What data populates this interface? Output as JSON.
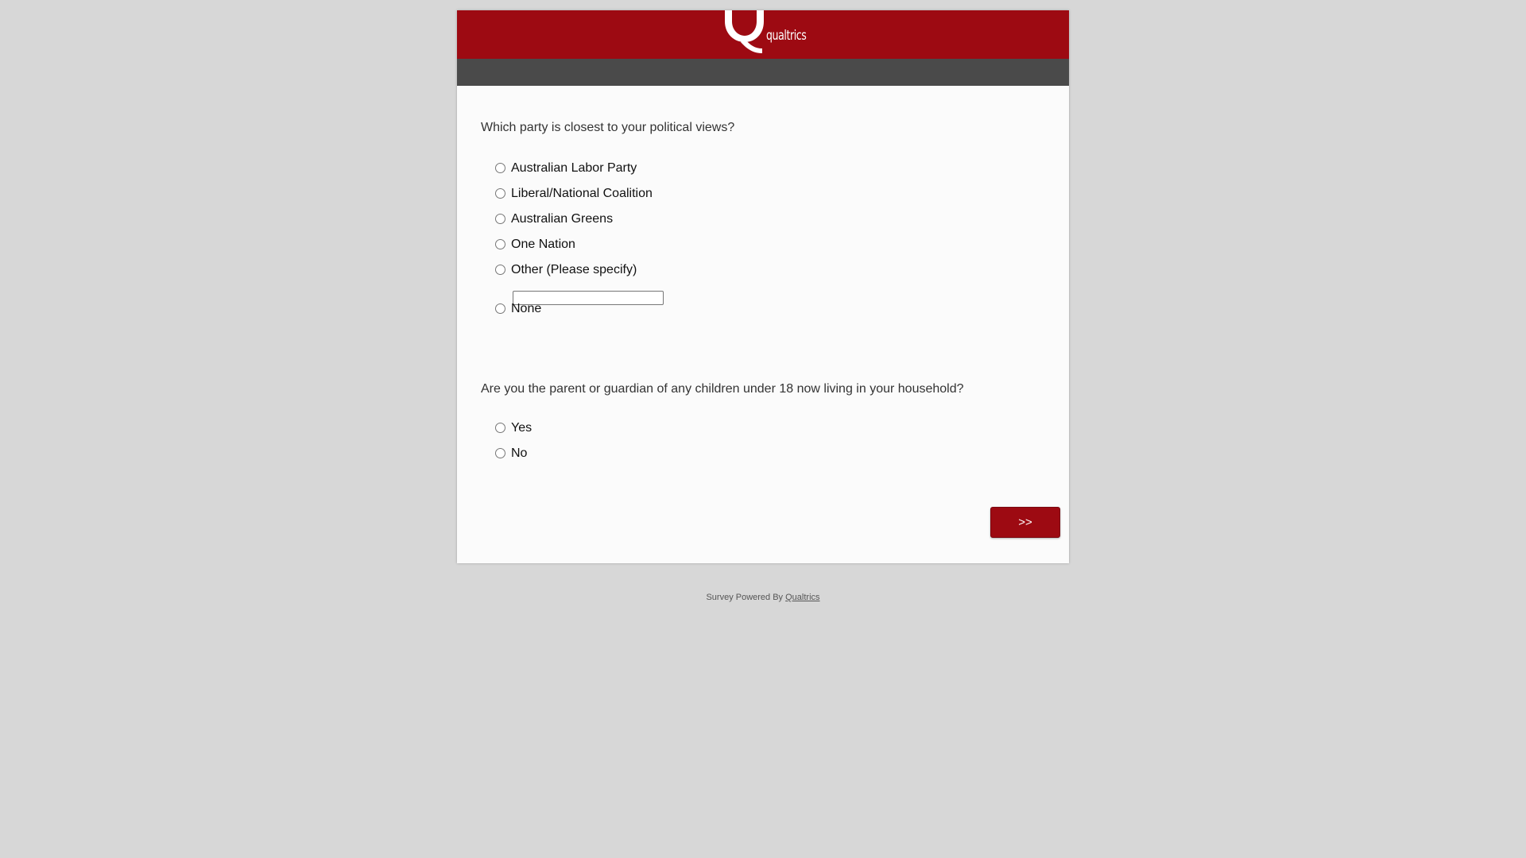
{
  "header": {
    "brand_text": "qualtrics",
    "brand_color": "#9d0a12",
    "progress_bar_color": "#4a4a4a"
  },
  "questions": [
    {
      "text": "Which party is closest to your political views?",
      "choices": [
        {
          "label": "Australian Labor Party"
        },
        {
          "label": "Liberal/National Coalition"
        },
        {
          "label": "Australian Greens"
        },
        {
          "label": "One Nation"
        },
        {
          "label": "Other (Please specify)",
          "other_input_value": ""
        },
        {
          "label": "None"
        }
      ]
    },
    {
      "text": "Are you the parent or guardian of any children under 18 now living in your household?",
      "choices": [
        {
          "label": "Yes"
        },
        {
          "label": "No"
        }
      ]
    }
  ],
  "navigation": {
    "next_label": ">>"
  },
  "footer": {
    "prefix": "Survey Powered By",
    "link_label": "Qualtrics"
  }
}
